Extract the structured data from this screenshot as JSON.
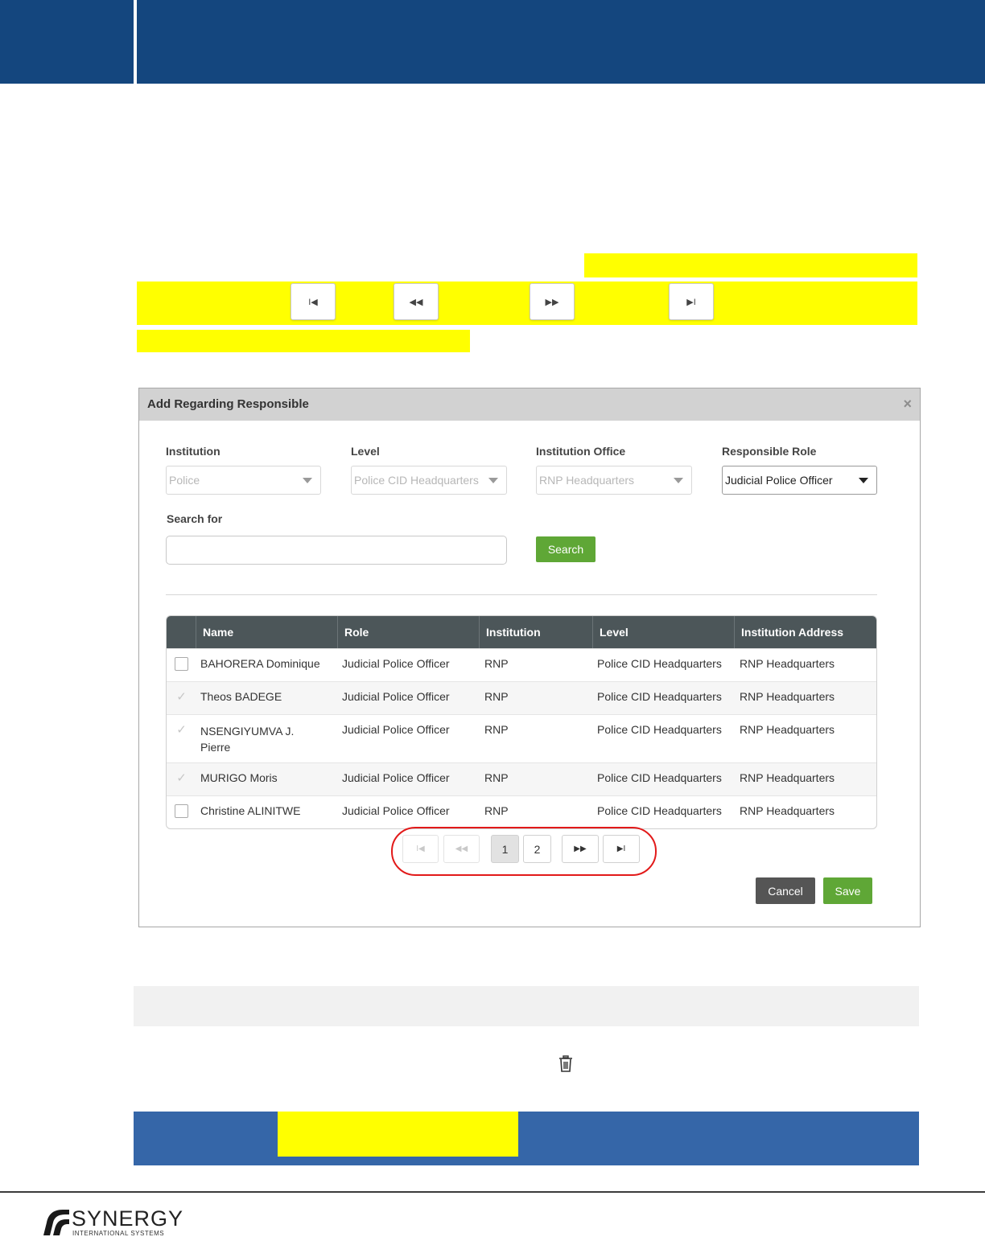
{
  "modal": {
    "title": "Add Regarding Responsible",
    "close_glyph": "×",
    "filters": {
      "institution": {
        "label": "Institution",
        "value": "Police"
      },
      "level": {
        "label": "Level",
        "value": "Police CID Headquarters"
      },
      "office": {
        "label": "Institution Office",
        "value": "RNP Headquarters"
      },
      "role": {
        "label": "Responsible Role",
        "value": "Judicial Police Officer"
      }
    },
    "search": {
      "label": "Search for",
      "value": "",
      "button": "Search"
    },
    "table": {
      "headers": [
        "Name",
        "Role",
        "Institution",
        "Level",
        "Institution Address"
      ],
      "rows": [
        {
          "checked": false,
          "name": "BAHORERA Dominique",
          "role": "Judicial Police Officer",
          "institution": "RNP",
          "level": "Police CID Headquarters",
          "address": "RNP Headquarters"
        },
        {
          "checked": true,
          "name": "Theos BADEGE",
          "role": "Judicial Police Officer",
          "institution": "RNP",
          "level": "Police CID Headquarters",
          "address": "RNP Headquarters"
        },
        {
          "checked": true,
          "name": "NSENGIYUMVA J. Pierre",
          "role": "Judicial Police Officer",
          "institution": "RNP",
          "level": "Police CID Headquarters",
          "address": "RNP Headquarters"
        },
        {
          "checked": true,
          "name": "MURIGO Moris",
          "role": "Judicial Police Officer",
          "institution": "RNP",
          "level": "Police CID Headquarters",
          "address": "RNP Headquarters"
        },
        {
          "checked": false,
          "name": "Christine ALINITWE",
          "role": "Judicial Police Officer",
          "institution": "RNP",
          "level": "Police CID Headquarters",
          "address": "RNP Headquarters"
        }
      ]
    },
    "pagination": {
      "first": "I◀",
      "prev": "◀◀",
      "pages": [
        "1",
        "2"
      ],
      "current": "1",
      "next": "▶▶",
      "last": "▶I"
    },
    "buttons": {
      "cancel": "Cancel",
      "save": "Save"
    }
  },
  "inline_nav_buttons": {
    "first": "I◀",
    "prev": "◀◀",
    "next": "▶▶",
    "last": "▶I"
  },
  "footer": {
    "logo_name": "SYNERGY",
    "logo_sub": "INTERNATIONAL SYSTEMS"
  },
  "colors": {
    "header_blue": "#14467e",
    "band_blue": "#3566a8",
    "highlight": "#ffff00",
    "green_button": "#5fa736",
    "table_header": "#4c5659"
  }
}
